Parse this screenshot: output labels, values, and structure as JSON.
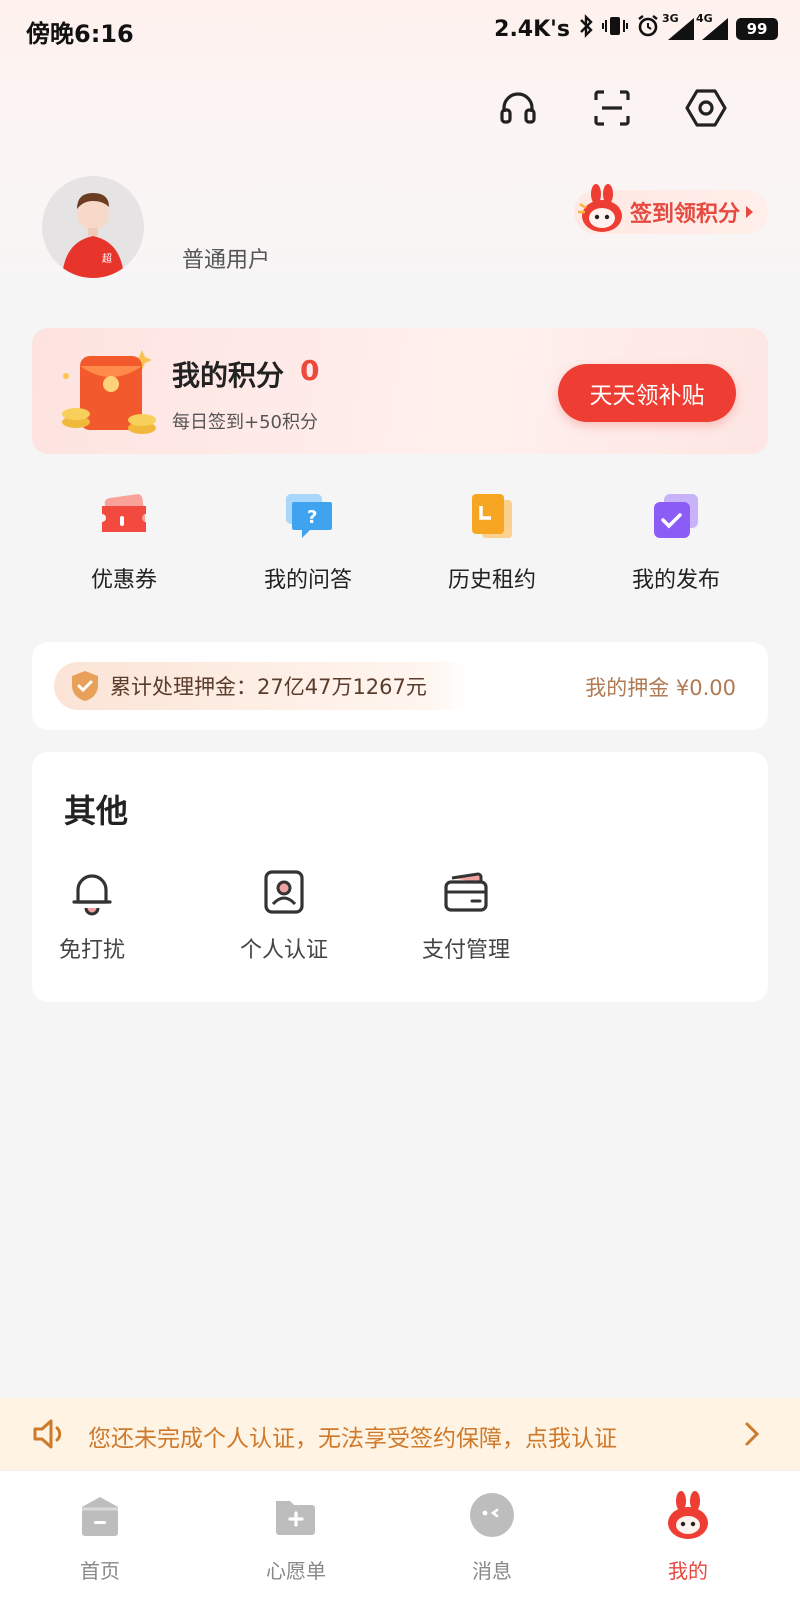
{
  "status_bar": {
    "time": "傍晚6:16",
    "speed": "2.4K's",
    "signal_labels": [
      "3G",
      "4G"
    ],
    "battery": "99"
  },
  "top_actions": {
    "icons": [
      "headset-icon",
      "scan-icon",
      "settings-icon"
    ]
  },
  "profile": {
    "user_type": "普通用户",
    "checkin_label": "签到领积分"
  },
  "points_card": {
    "title": "我的积分",
    "value": "0",
    "subtitle": "每日签到+50积分",
    "button_label": "天天领补贴"
  },
  "quick_menu": [
    {
      "label": "优惠券",
      "icon": "coupon-icon",
      "color": "#f24a3f"
    },
    {
      "label": "我的问答",
      "icon": "qa-icon",
      "color": "#3fa3f0"
    },
    {
      "label": "历史租约",
      "icon": "lease-history-icon",
      "color": "#f6a623"
    },
    {
      "label": "我的发布",
      "icon": "my-posts-icon",
      "color": "#8b5cf6"
    }
  ],
  "deposit": {
    "processed_label": "累计处理押金：27亿47万1267元",
    "my_deposit_label": "我的押金 ¥0.00"
  },
  "other": {
    "title": "其他",
    "items": [
      {
        "label": "免打扰",
        "icon": "do-not-disturb-icon"
      },
      {
        "label": "个人认证",
        "icon": "personal-verification-icon"
      },
      {
        "label": "支付管理",
        "icon": "payment-management-icon"
      }
    ]
  },
  "notice": {
    "text": "您还未完成个人认证，无法享受签约保障，点我认证"
  },
  "bottom_nav": [
    {
      "label": "首页",
      "icon": "home-icon",
      "active": false
    },
    {
      "label": "心愿单",
      "icon": "wishlist-icon",
      "active": false
    },
    {
      "label": "消息",
      "icon": "messages-icon",
      "active": false
    },
    {
      "label": "我的",
      "icon": "mine-icon",
      "active": true
    }
  ],
  "colors": {
    "accent": "#ee3d33",
    "notice_text": "#ce7a2c",
    "deposit_text": "#b07a53"
  }
}
